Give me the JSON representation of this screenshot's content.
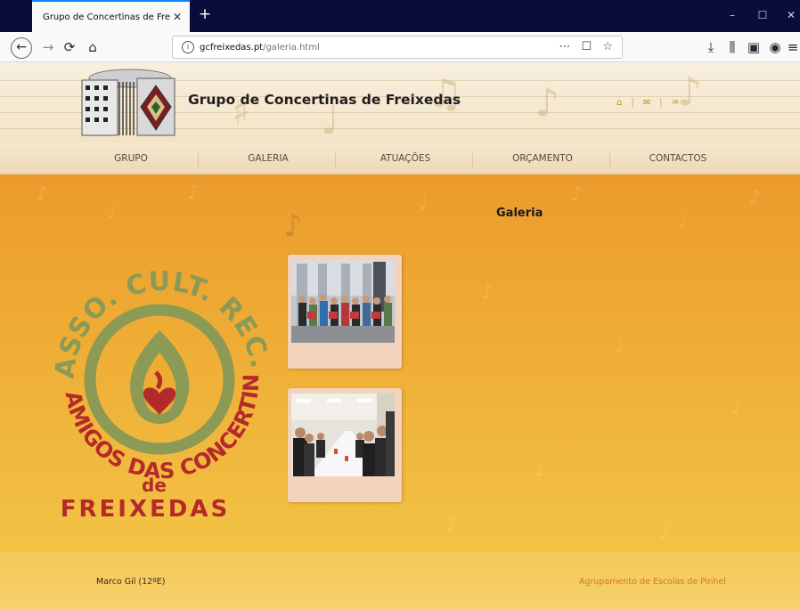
{
  "browser": {
    "tab_title": "Grupo de Concertinas de Freixedas",
    "tab_close": "✕",
    "new_tab": "+",
    "url_host": "gcfreixedas.pt",
    "url_path": "/galeria.html",
    "url_actions": "⋯ ☐ ☆",
    "window": {
      "minimize": "–",
      "maximize": "☐",
      "close": "✕"
    },
    "toolbar_icons": [
      "back-icon",
      "forward-icon",
      "reload-icon",
      "home-icon",
      "page-actions-icon",
      "pocket-icon",
      "bookmark-star-icon",
      "download-icon",
      "library-icon",
      "sidebar-icon",
      "account-icon",
      "menu-icon"
    ],
    "glyphs": {
      "back": "←",
      "forward": "→",
      "reload": "⟳",
      "home": "⌂",
      "download": "⤓",
      "library": "⫼",
      "sidebar": "▣",
      "account": "◉",
      "menu": "≡",
      "info": "i"
    }
  },
  "site": {
    "title": "Grupo de Concertinas de Freixedas",
    "quicklinks": {
      "home": "⌂",
      "sep1": "|",
      "mail": "✉",
      "sep2": "|",
      "sitemap": "♒"
    },
    "nav": [
      "GRUPO",
      "GALERIA",
      "ATUAÇÕES",
      "ORÇAMENTO",
      "CONTACTOS"
    ]
  },
  "content": {
    "heading": "Galeria",
    "note_glyph": "♪",
    "logo_text": {
      "top_arc": "ASSO. CULT. REC. DESP.",
      "bottom_arc": "AMIGOS DAS CONCERTINAS",
      "de": "de",
      "place": "FREIXEDAS"
    },
    "photos": [
      {
        "alt": "group-photo-outdoors"
      },
      {
        "alt": "group-dinner-photo"
      }
    ]
  },
  "footer": {
    "left": "Marco Gil (12ºE)",
    "right": "Agrupamento de Escolas de Pinhel"
  },
  "colors": {
    "orange_top": "#ec9b2c",
    "orange_bottom": "#f2c345",
    "nav_text": "#5a4a36",
    "footer_link": "#d47a12",
    "logo_green": "#8b9a55",
    "logo_red": "#b42a2a"
  }
}
